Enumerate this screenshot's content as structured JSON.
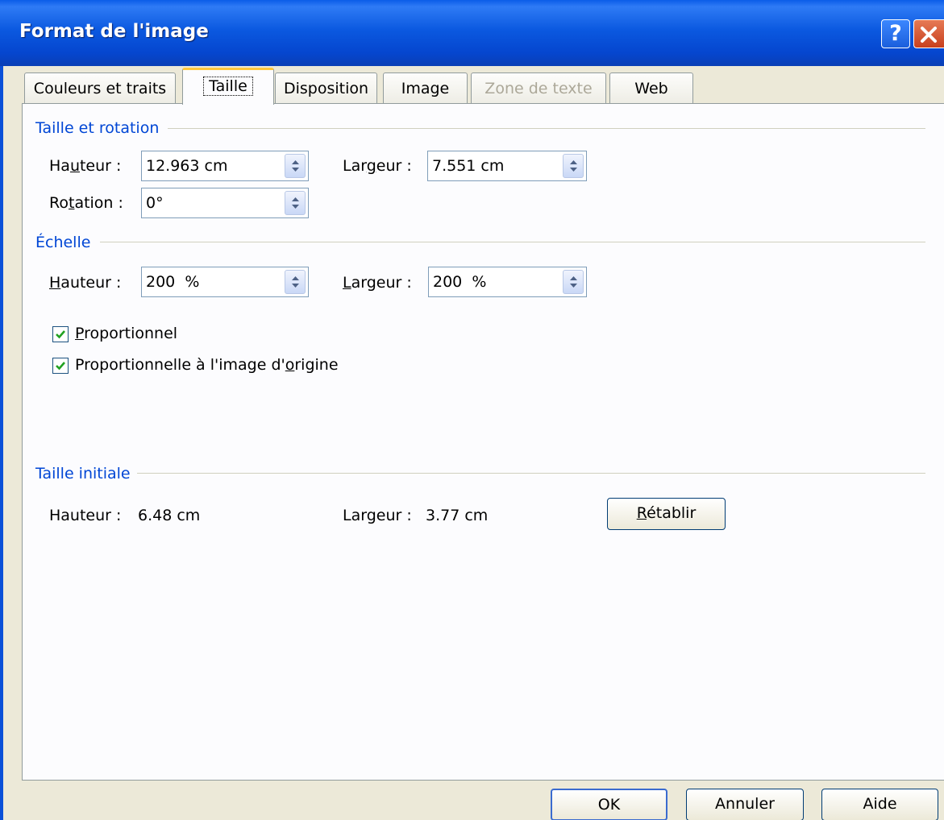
{
  "window": {
    "title": "Format de l'image",
    "help_label": "?",
    "close_icon": "close-icon"
  },
  "tabs": [
    {
      "label": "Couleurs et traits",
      "state": "normal"
    },
    {
      "label": "Taille",
      "state": "active"
    },
    {
      "label": "Disposition",
      "state": "normal"
    },
    {
      "label": "Image",
      "state": "normal"
    },
    {
      "label": "Zone de texte",
      "state": "disabled"
    },
    {
      "label": "Web",
      "state": "normal"
    }
  ],
  "size_rotation": {
    "group_label": "Taille et rotation",
    "height_label_pre": "Ha",
    "height_label_ul": "u",
    "height_label_post": "teur :",
    "height_value": "12.963 cm",
    "width_label_pre": "Lar",
    "width_label_ul": "g",
    "width_label_post": "eur :",
    "width_value": "7.551 cm",
    "rotation_label_pre": "Ro",
    "rotation_label_ul": "t",
    "rotation_label_post": "ation :",
    "rotation_value": "0°"
  },
  "scale": {
    "group_label": "Échelle",
    "height_label_ul": "H",
    "height_label_post": "auteur :",
    "height_value": "200  %",
    "width_label_ul": "L",
    "width_label_post": "argeur :",
    "width_value": "200  %",
    "lock_ratio_ul": "P",
    "lock_ratio_post": "roportionnel",
    "lock_ratio_checked": true,
    "relative_pre": "Proportionnelle à l'image d'",
    "relative_ul": "o",
    "relative_post": "rigine",
    "relative_checked": true
  },
  "original_size": {
    "group_label": "Taille initiale",
    "height_label": "Hauteur :",
    "height_value": "6.48 cm",
    "width_label": "Largeur :",
    "width_value": "3.77 cm",
    "reset_ul": "R",
    "reset_post": "établir"
  },
  "footer": {
    "ok_label": "OK",
    "cancel_label": "Annuler",
    "help_label": "Aide"
  }
}
